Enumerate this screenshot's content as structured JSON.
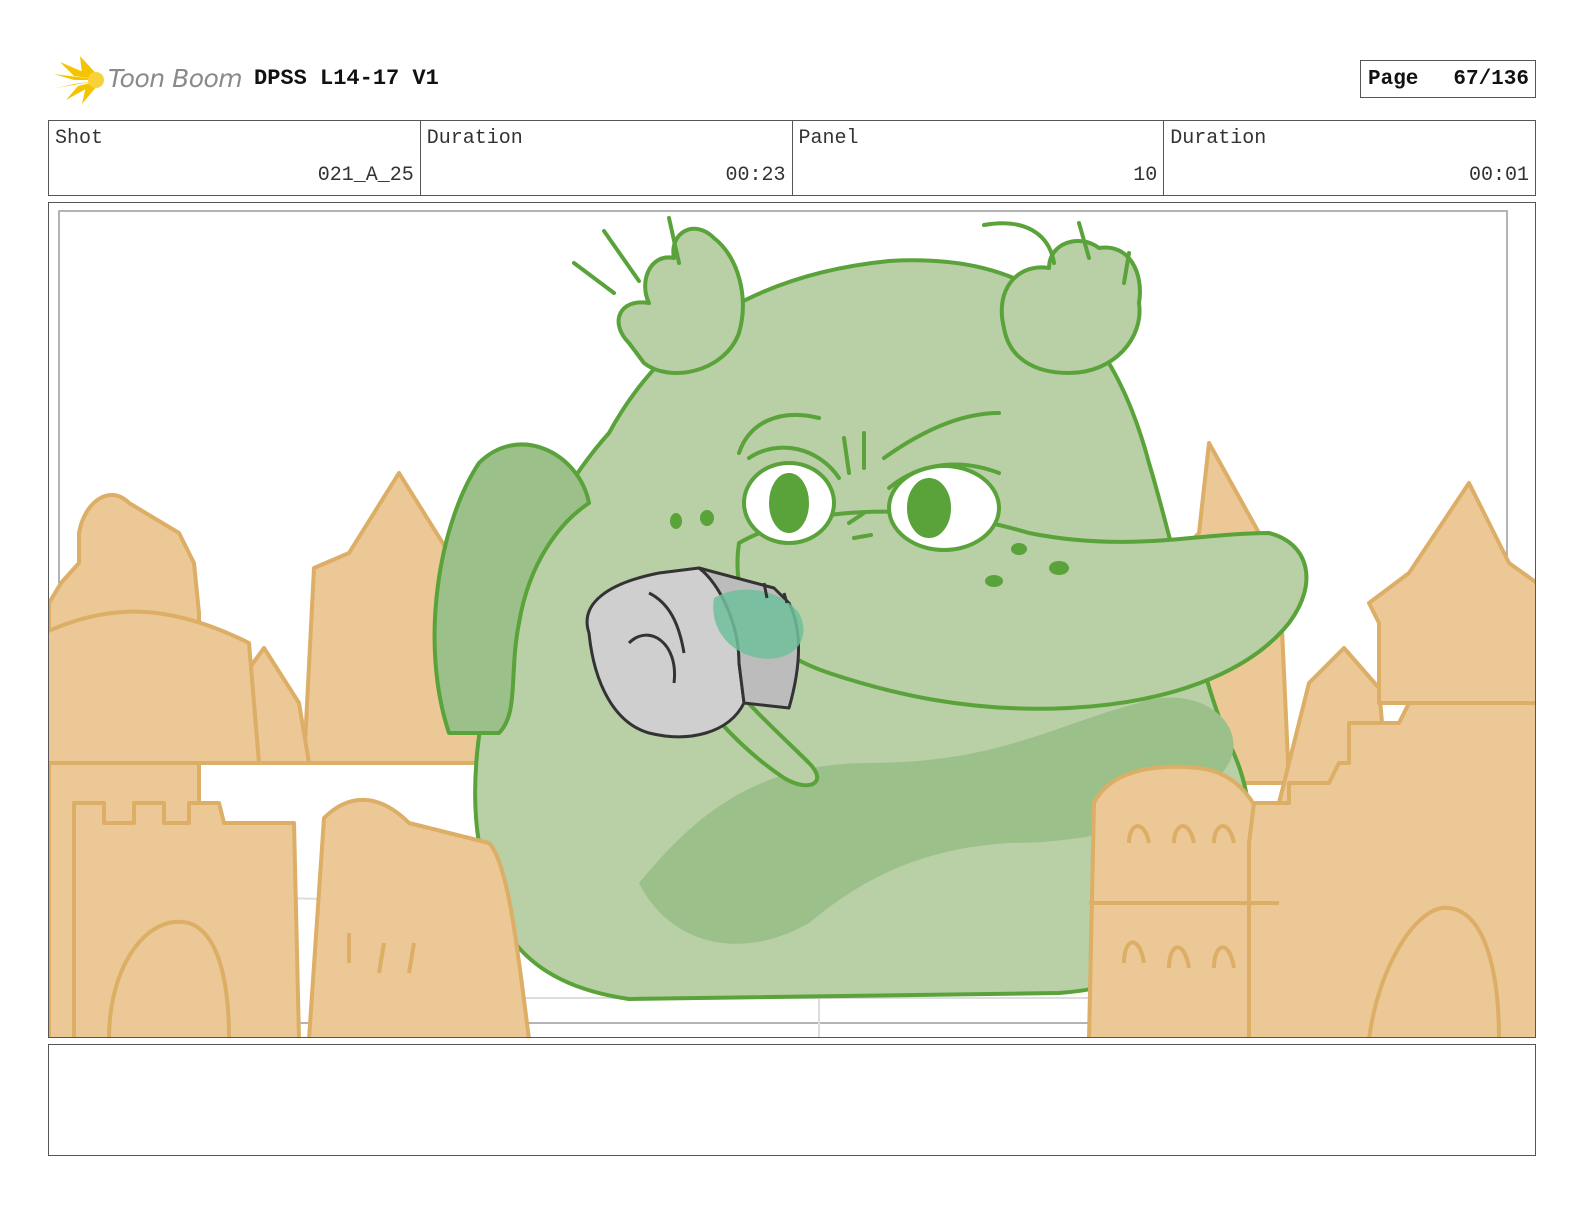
{
  "header": {
    "logo_text": "Toon Boom",
    "project_title": "DPSS L14-17 V1",
    "page_label": "Page",
    "page_value": "67/136"
  },
  "info": {
    "shot_label": "Shot",
    "shot_value": "021_A_25",
    "shot_duration_label": "Duration",
    "shot_duration_value": "00:23",
    "panel_label": "Panel",
    "panel_value": "10",
    "panel_duration_label": "Duration",
    "panel_duration_value": "00:01"
  },
  "notes": {
    "text": ""
  },
  "colors": {
    "sand": "#e8c48f",
    "sand_line": "#d9a95c",
    "monster_fill": "#b9cfa6",
    "monster_line": "#5aa23a",
    "bucket": "#cfcfcf",
    "logo_yellow": "#f5c400"
  },
  "icons": [
    "toon-boom-logo-icon"
  ]
}
